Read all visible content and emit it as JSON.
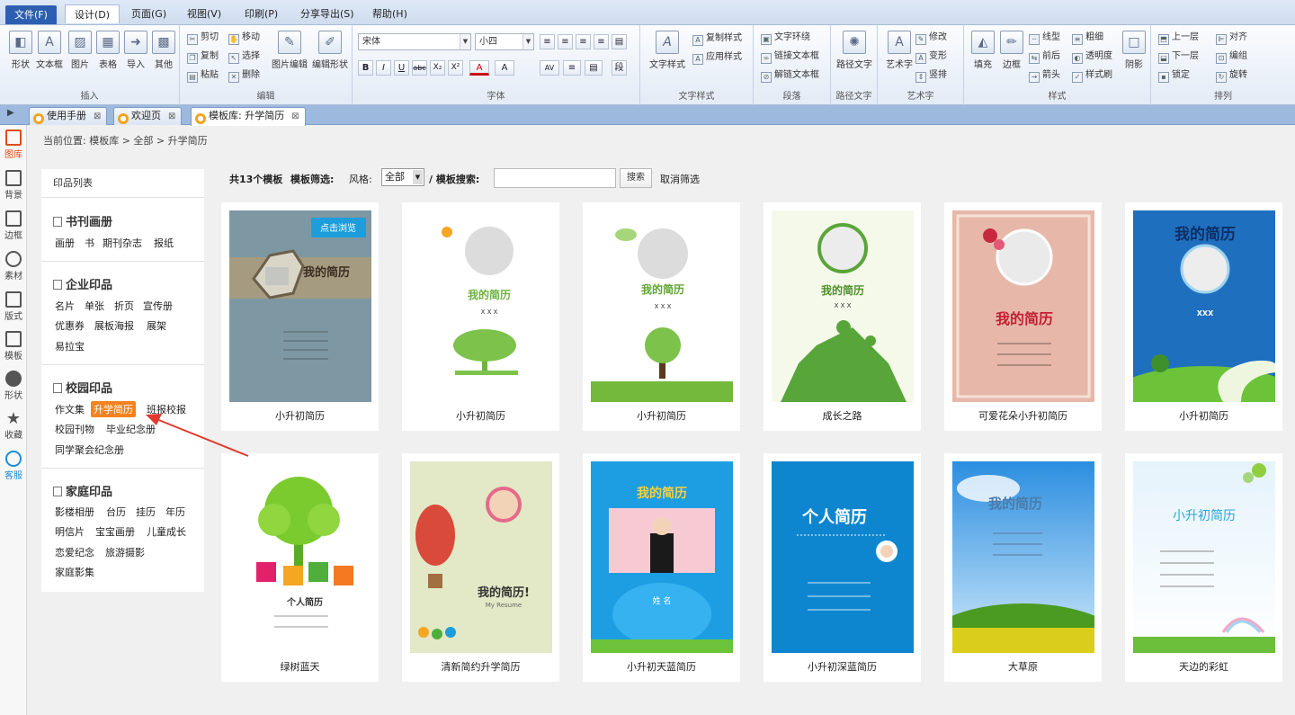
{
  "menubar": {
    "items": [
      "文件(F)",
      "设计(D)",
      "页面(G)",
      "视图(V)",
      "印刷(P)",
      "分享导出(S)",
      "帮助(H)"
    ]
  },
  "ribbon": {
    "insert": {
      "label": "插入",
      "buttons": [
        "形状",
        "文本框",
        "图片",
        "表格",
        "导入",
        "其他"
      ]
    },
    "edit": {
      "label": "编辑",
      "buttons": [
        "剪切",
        "移动",
        "复制",
        "选择",
        "粘贴",
        "删除",
        "图片编辑",
        "编辑形状"
      ]
    },
    "font": {
      "label": "字体",
      "font_name": "宋体",
      "font_size": "小四",
      "format_buttons": [
        "B",
        "I",
        "U",
        "abc",
        "X₂",
        "X²",
        "A",
        "A",
        "AV",
        "≡",
        "▤",
        "段"
      ]
    },
    "text_style": {
      "label": "文字样式",
      "big": "文字样式",
      "copy": "复制样式",
      "apply": "应用样式"
    },
    "paragraph": {
      "label": "段落",
      "items": [
        "文字环绕",
        "链接文本框",
        "解链文本框"
      ]
    },
    "path_text": {
      "label": "路径文字",
      "big": "路径文字"
    },
    "art_text": {
      "label": "艺术字",
      "big": "艺术字",
      "items": [
        "修改",
        "变形",
        "竖排"
      ]
    },
    "style": {
      "label": "样式",
      "fill": "填充",
      "border": "边框",
      "items": [
        "线型",
        "粗细",
        "前后",
        "透明度",
        "箭头",
        "样式刷"
      ],
      "shadow": "阴影"
    },
    "arrange": {
      "label": "排列",
      "items": [
        "上一层",
        "对齐",
        "下一层",
        "编组",
        "锁定",
        "旋转"
      ]
    }
  },
  "tabs": [
    {
      "label": "使用手册",
      "icon": "book-icon"
    },
    {
      "label": "欢迎页",
      "icon": "home-icon"
    },
    {
      "label": "模板库: 升学简历",
      "icon": "template-icon"
    }
  ],
  "sidebar": [
    {
      "label": "图库",
      "icon": "gallery-icon"
    },
    {
      "label": "背景",
      "icon": "background-icon"
    },
    {
      "label": "边框",
      "icon": "border-icon"
    },
    {
      "label": "素材",
      "icon": "material-icon"
    },
    {
      "label": "版式",
      "icon": "layout-icon"
    },
    {
      "label": "模板",
      "icon": "template-icon"
    },
    {
      "label": "形状",
      "icon": "shape-icon"
    },
    {
      "label": "收藏",
      "icon": "star-icon"
    },
    {
      "label": "客服",
      "icon": "chat-icon"
    }
  ],
  "breadcrumb": "当前位置: 模板库 > 全部 > 升学简历",
  "categories": {
    "header": "印品列表",
    "sections": [
      {
        "title": "书刊画册",
        "links": [
          "画册",
          "书",
          "期刊杂志",
          "报纸"
        ]
      },
      {
        "title": "企业印品",
        "links": [
          "名片",
          "单张",
          "折页",
          "宣传册",
          "优惠券",
          "展板海报",
          "展架",
          "易拉宝"
        ]
      },
      {
        "title": "校园印品",
        "links": [
          "作文集",
          "升学简历",
          "班报校报",
          "校园刊物",
          "毕业纪念册",
          "同学聚会纪念册"
        ]
      },
      {
        "title": "家庭印品",
        "links": [
          "影楼相册",
          "台历",
          "挂历",
          "年历",
          "明信片",
          "宝宝画册",
          "儿童成长",
          "恋爱纪念",
          "旅游摄影",
          "家庭影集"
        ]
      }
    ]
  },
  "filter": {
    "count_text": "共13个模板",
    "filter_label": "模板筛选:",
    "style_label": "风格:",
    "style_value": "全部",
    "search_label": "/ 模板搜索:",
    "search_placeholder": "",
    "search_button": "搜索",
    "clear_button": "取消筛选"
  },
  "templates": [
    {
      "name": "小升初简历",
      "title": "我的简历",
      "overlay": "点击浏览"
    },
    {
      "name": "小升初简历",
      "title": "我的简历",
      "sub": "X X X"
    },
    {
      "name": "小升初简历",
      "title": "我的简历",
      "sub": "X X X"
    },
    {
      "name": "成长之路",
      "title": "我的简历",
      "sub": "X X X"
    },
    {
      "name": "可爱花朵小升初简历",
      "title": "我的简历"
    },
    {
      "name": "小升初简历",
      "title": "我的简历",
      "sub": "XXX"
    },
    {
      "name": "绿树蓝天",
      "title": "个人简历"
    },
    {
      "name": "清新简约升学简历",
      "title": "我的简历!",
      "sub": "My Resume"
    },
    {
      "name": "小升初天蓝简历",
      "title": "我的简历",
      "sub": "姓  名"
    },
    {
      "name": "小升初深蓝简历",
      "title": "个人简历"
    },
    {
      "name": "大草原",
      "title": "我的简历"
    },
    {
      "name": "天边的彩虹",
      "title": "小升初简历"
    }
  ],
  "colors": {
    "accent": "#f5821f",
    "menu_file": "#2d5fb0",
    "tabbar": "#9db9dd"
  }
}
